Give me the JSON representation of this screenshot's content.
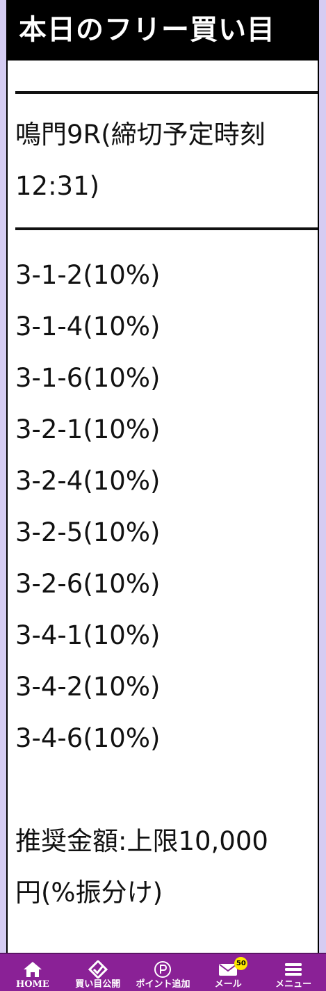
{
  "header": {
    "title": "本日のフリー買い目"
  },
  "race": {
    "line1": "鳴門9R(締切予定時刻",
    "line2": "12:31)"
  },
  "combos": [
    "3-1-2(10%)",
    "3-1-4(10%)",
    "3-1-6(10%)",
    "3-2-1(10%)",
    "3-2-4(10%)",
    "3-2-5(10%)",
    "3-2-6(10%)",
    "3-4-1(10%)",
    "3-4-2(10%)",
    "3-4-6(10%)"
  ],
  "recommend": {
    "line1": "推奨金額:上限10,000",
    "line2": "円(%振分け)"
  },
  "tabbar": {
    "items": [
      {
        "label": "HOME",
        "icon": "home-icon"
      },
      {
        "label": "買い目公開",
        "icon": "check-badge-icon"
      },
      {
        "label": "ポイント追加",
        "icon": "point-icon"
      },
      {
        "label": "メール",
        "icon": "mail-icon",
        "badge": "50"
      },
      {
        "label": "メニュー",
        "icon": "menu-icon"
      }
    ]
  },
  "colors": {
    "background": "#d5ccf2",
    "header_bg": "#000000",
    "tabbar_bg": "#8a2196",
    "badge_bg": "#ffe800"
  }
}
